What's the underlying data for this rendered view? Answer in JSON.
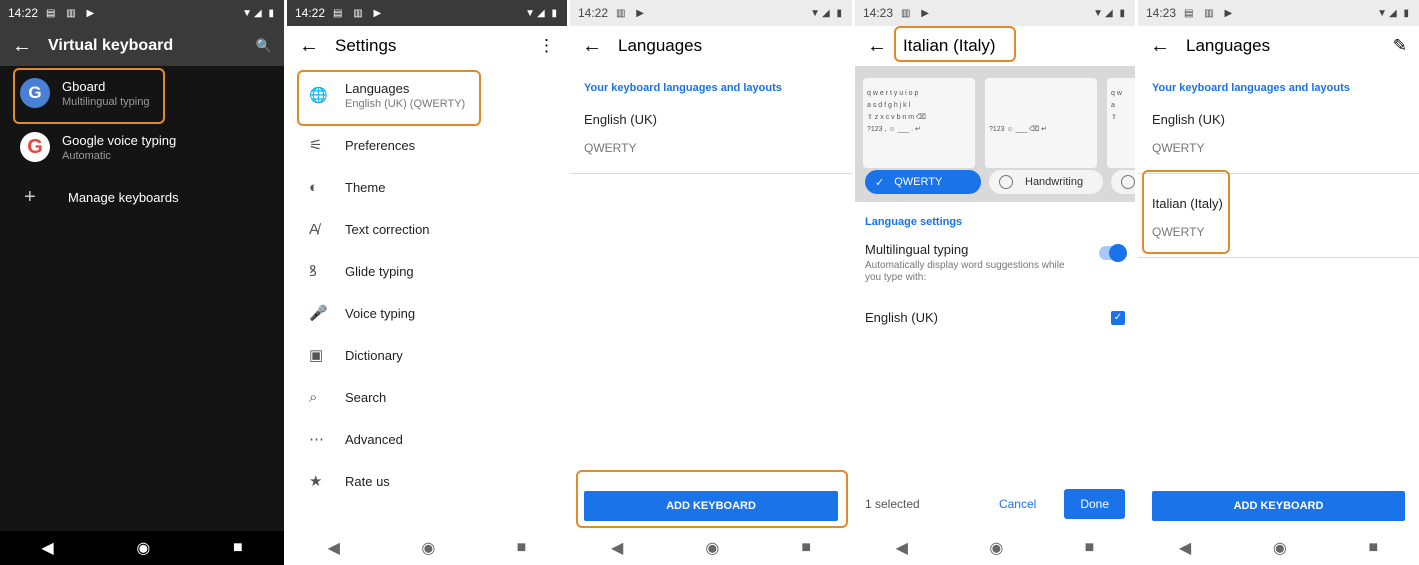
{
  "panels": {
    "virtual_keyboard": {
      "status": {
        "time": "14:22",
        "icons": "▤ ▥ ▶",
        "right": "▼◢ ▮"
      },
      "title": "Virtual keyboard",
      "items": [
        {
          "title": "Gboard",
          "subtitle": "Multilingual typing",
          "icon": "G"
        },
        {
          "title": "Google voice typing",
          "subtitle": "Automatic",
          "icon": "G"
        }
      ],
      "manage": "Manage keyboards"
    },
    "settings": {
      "status": {
        "time": "14:22",
        "icons": "▤ ▥ ▶",
        "right": "▼◢ ▮"
      },
      "title": "Settings",
      "languages": {
        "label": "Languages",
        "sub": "English (UK) (QWERTY)"
      },
      "items": [
        "Preferences",
        "Theme",
        "Text correction",
        "Glide typing",
        "Voice typing",
        "Dictionary",
        "Search",
        "Advanced",
        "Rate us"
      ]
    },
    "languages_a": {
      "status": {
        "time": "14:22",
        "icons": "▥ ▶",
        "right": "▼◢ ▮"
      },
      "title": "Languages",
      "section": "Your keyboard languages and layouts",
      "lang": "English (UK)",
      "layout": "QWERTY",
      "add_button": "ADD KEYBOARD"
    },
    "italian": {
      "status": {
        "time": "14:23",
        "icons": "▥ ▶",
        "right": "▼◢ ▮"
      },
      "title": "Italian (Italy)",
      "chip_selected": "QWERTY",
      "chip_unselected": "Handwriting",
      "section": "Language settings",
      "multilingual_title": "Multilingual typing",
      "multilingual_sub": "Automatically display word suggestions while you type with:",
      "english": "English (UK)",
      "selected_count": "1 selected",
      "cancel": "Cancel",
      "done": "Done"
    },
    "languages_b": {
      "status": {
        "time": "14:23",
        "icons": "▤ ▥ ▶",
        "right": "▼◢ ▮"
      },
      "title": "Languages",
      "section": "Your keyboard languages and layouts",
      "lang1": "English (UK)",
      "layout1": "QWERTY",
      "lang2": "Italian (Italy)",
      "layout2": "QWERTY",
      "add_button": "ADD KEYBOARD"
    }
  },
  "icons": {
    "back": "←",
    "search": "🔍",
    "more": "⋮",
    "edit": "✎",
    "nav_back": "◀",
    "nav_home": "◉",
    "nav_recent": "■",
    "globe": "🌐",
    "preferences": "⚟",
    "theme": "◐",
    "text_correction": "A̸",
    "glide": "ꝸ",
    "voice": "🎤",
    "dictionary": "▣",
    "search_item": "⌕",
    "advanced": "⋯",
    "rate": "★",
    "check": "✓",
    "plus": "+"
  },
  "colors": {
    "accent": "#1a73e8",
    "highlight": "#e08a2e"
  }
}
